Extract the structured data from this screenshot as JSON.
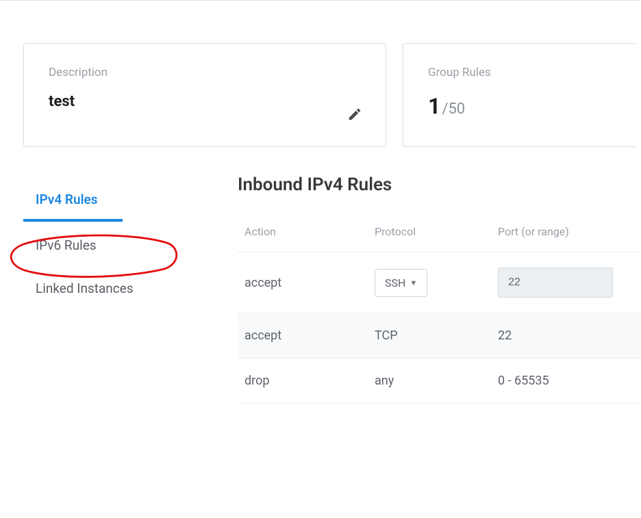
{
  "description_card": {
    "label": "Description",
    "value": "test"
  },
  "group_card": {
    "label": "Group Rules",
    "count": "1",
    "limit": "50"
  },
  "sidebar": {
    "items": [
      {
        "label": "IPv4 Rules",
        "active": true
      },
      {
        "label": "IPv6 Rules",
        "active": false
      },
      {
        "label": "Linked Instances",
        "active": false
      }
    ]
  },
  "main": {
    "title": "Inbound IPv4 Rules",
    "columns": {
      "action": "Action",
      "protocol": "Protocol",
      "port": "Port (or range)"
    },
    "rows": [
      {
        "action": "accept",
        "protocol": "SSH",
        "port": "22",
        "port_editable": true,
        "proto_select": true
      },
      {
        "action": "accept",
        "protocol": "TCP",
        "port": "22",
        "port_editable": false,
        "proto_select": false
      },
      {
        "action": "drop",
        "protocol": "any",
        "port": "0 - 65535",
        "port_editable": false,
        "proto_select": false
      }
    ]
  }
}
